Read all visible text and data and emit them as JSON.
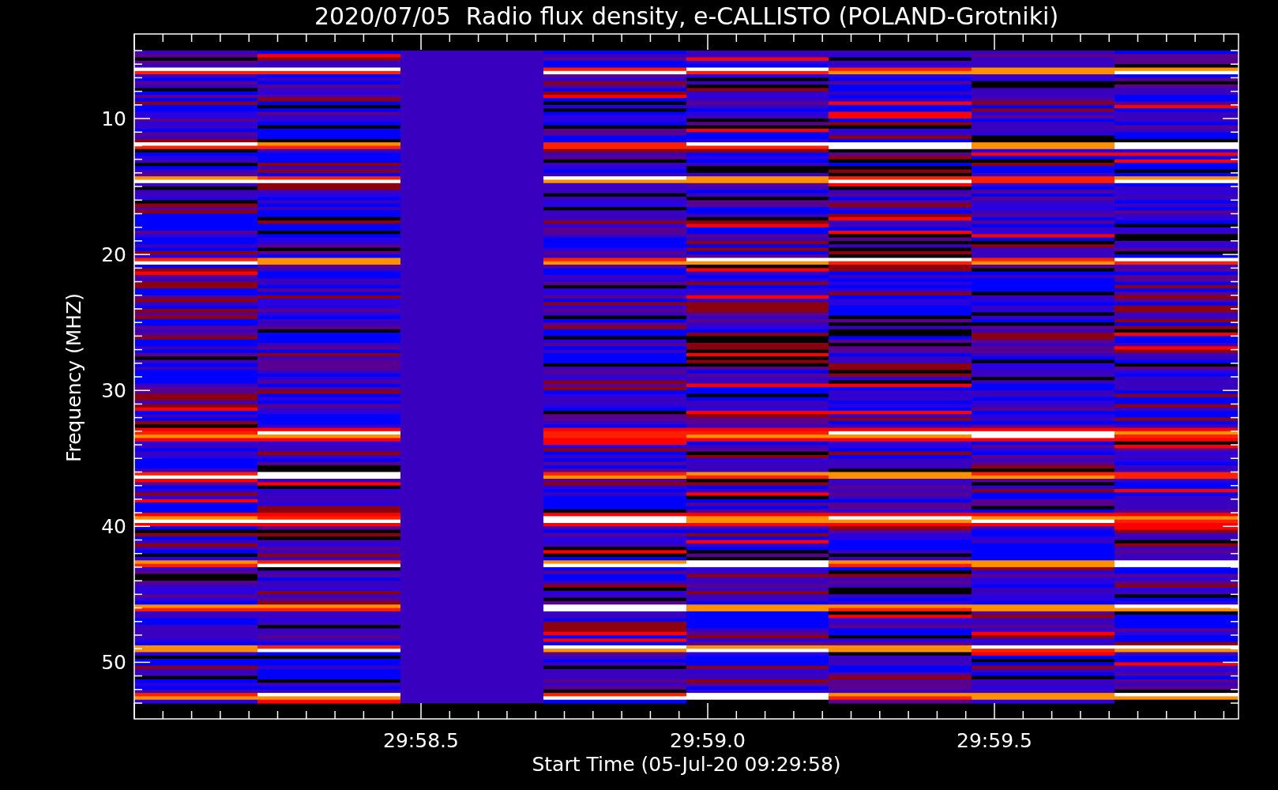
{
  "chart": {
    "title": "2020/07/05  Radio flux density, e-CALLISTO (POLAND-Grotniki)",
    "ylabel": "Frequency (MHZ)",
    "xlabel": "Start Time (05-Jul-20 09:29:58)",
    "yticks": [
      "10",
      "20",
      "30",
      "40",
      "50"
    ],
    "xticks": [
      "29:58.5",
      "29:59.0",
      "29:59.5"
    ]
  }
}
